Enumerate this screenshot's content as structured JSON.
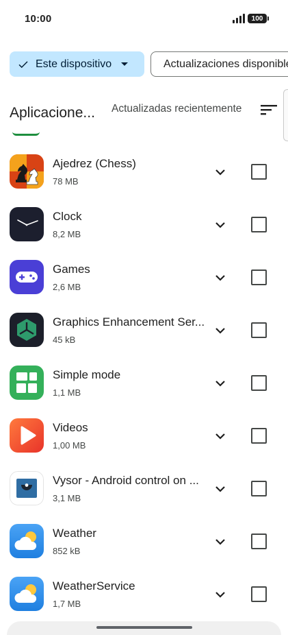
{
  "status_bar": {
    "time": "10:00",
    "battery": "100"
  },
  "filters": {
    "active_label": "Este dispositivo",
    "secondary_label": "Actualizaciones disponibles"
  },
  "section": {
    "title": "Aplicacione...",
    "sort_label": "Actualizadas recientemente"
  },
  "apps": [
    {
      "name": "Ajedrez (Chess)",
      "size": "78 MB",
      "icon": "chess-icon",
      "checked": false
    },
    {
      "name": "Clock",
      "size": "8,2 MB",
      "icon": "clock-icon",
      "checked": false
    },
    {
      "name": "Games",
      "size": "2,6 MB",
      "icon": "gamepad-icon",
      "checked": false
    },
    {
      "name": "Graphics Enhancement Ser...",
      "size": "45 kB",
      "icon": "graphics-enhancement-icon",
      "checked": false
    },
    {
      "name": "Simple mode",
      "size": "1,1 MB",
      "icon": "simple-mode-icon",
      "checked": false
    },
    {
      "name": "Videos",
      "size": "1,00 MB",
      "icon": "video-play-icon",
      "checked": false
    },
    {
      "name": "Vysor - Android control on ...",
      "size": "3,1 MB",
      "icon": "vysor-icon",
      "checked": false
    },
    {
      "name": "Weather",
      "size": "852 kB",
      "icon": "weather-icon",
      "checked": false
    },
    {
      "name": "WeatherService",
      "size": "1,7 MB",
      "icon": "weather-service-icon",
      "checked": false
    }
  ],
  "colors": {
    "chip_active_bg": "#c2e7ff",
    "chip_active_text": "#001d35",
    "text_primary": "#1f1f1f",
    "text_secondary": "#444746"
  }
}
